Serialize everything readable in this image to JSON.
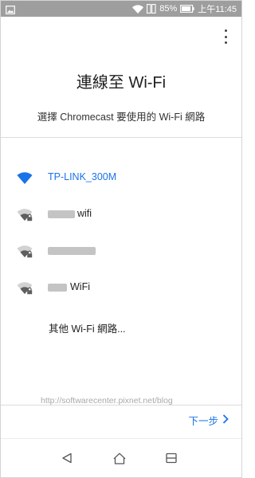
{
  "status_bar": {
    "battery_text": "85%",
    "time": "上午11:45"
  },
  "header": {
    "title": "連線至 Wi-Fi",
    "subtitle": "選擇 Chromecast 要使用的 Wi-Fi 網路"
  },
  "networks": [
    {
      "name": "TP-LINK_300M",
      "secured": false,
      "selected": true
    },
    {
      "name": "wifi",
      "secured": true,
      "selected": false
    },
    {
      "name": "",
      "secured": true,
      "selected": false
    },
    {
      "name": "WiFi",
      "secured": true,
      "selected": false
    }
  ],
  "other_network_label": "其他 Wi-Fi 網路...",
  "watermark": "http://softwarecenter.pixnet.net/blog",
  "next_label": "下一步",
  "colors": {
    "accent": "#1a73e8",
    "status_bar": "#9e9e9e"
  },
  "icons": [
    "gallery-icon",
    "wifi-status-icon",
    "sim-icon",
    "battery-icon",
    "overflow-menu-icon",
    "wifi-icon",
    "lock-icon",
    "chevron-right-icon",
    "back-icon",
    "home-icon",
    "recents-icon"
  ]
}
